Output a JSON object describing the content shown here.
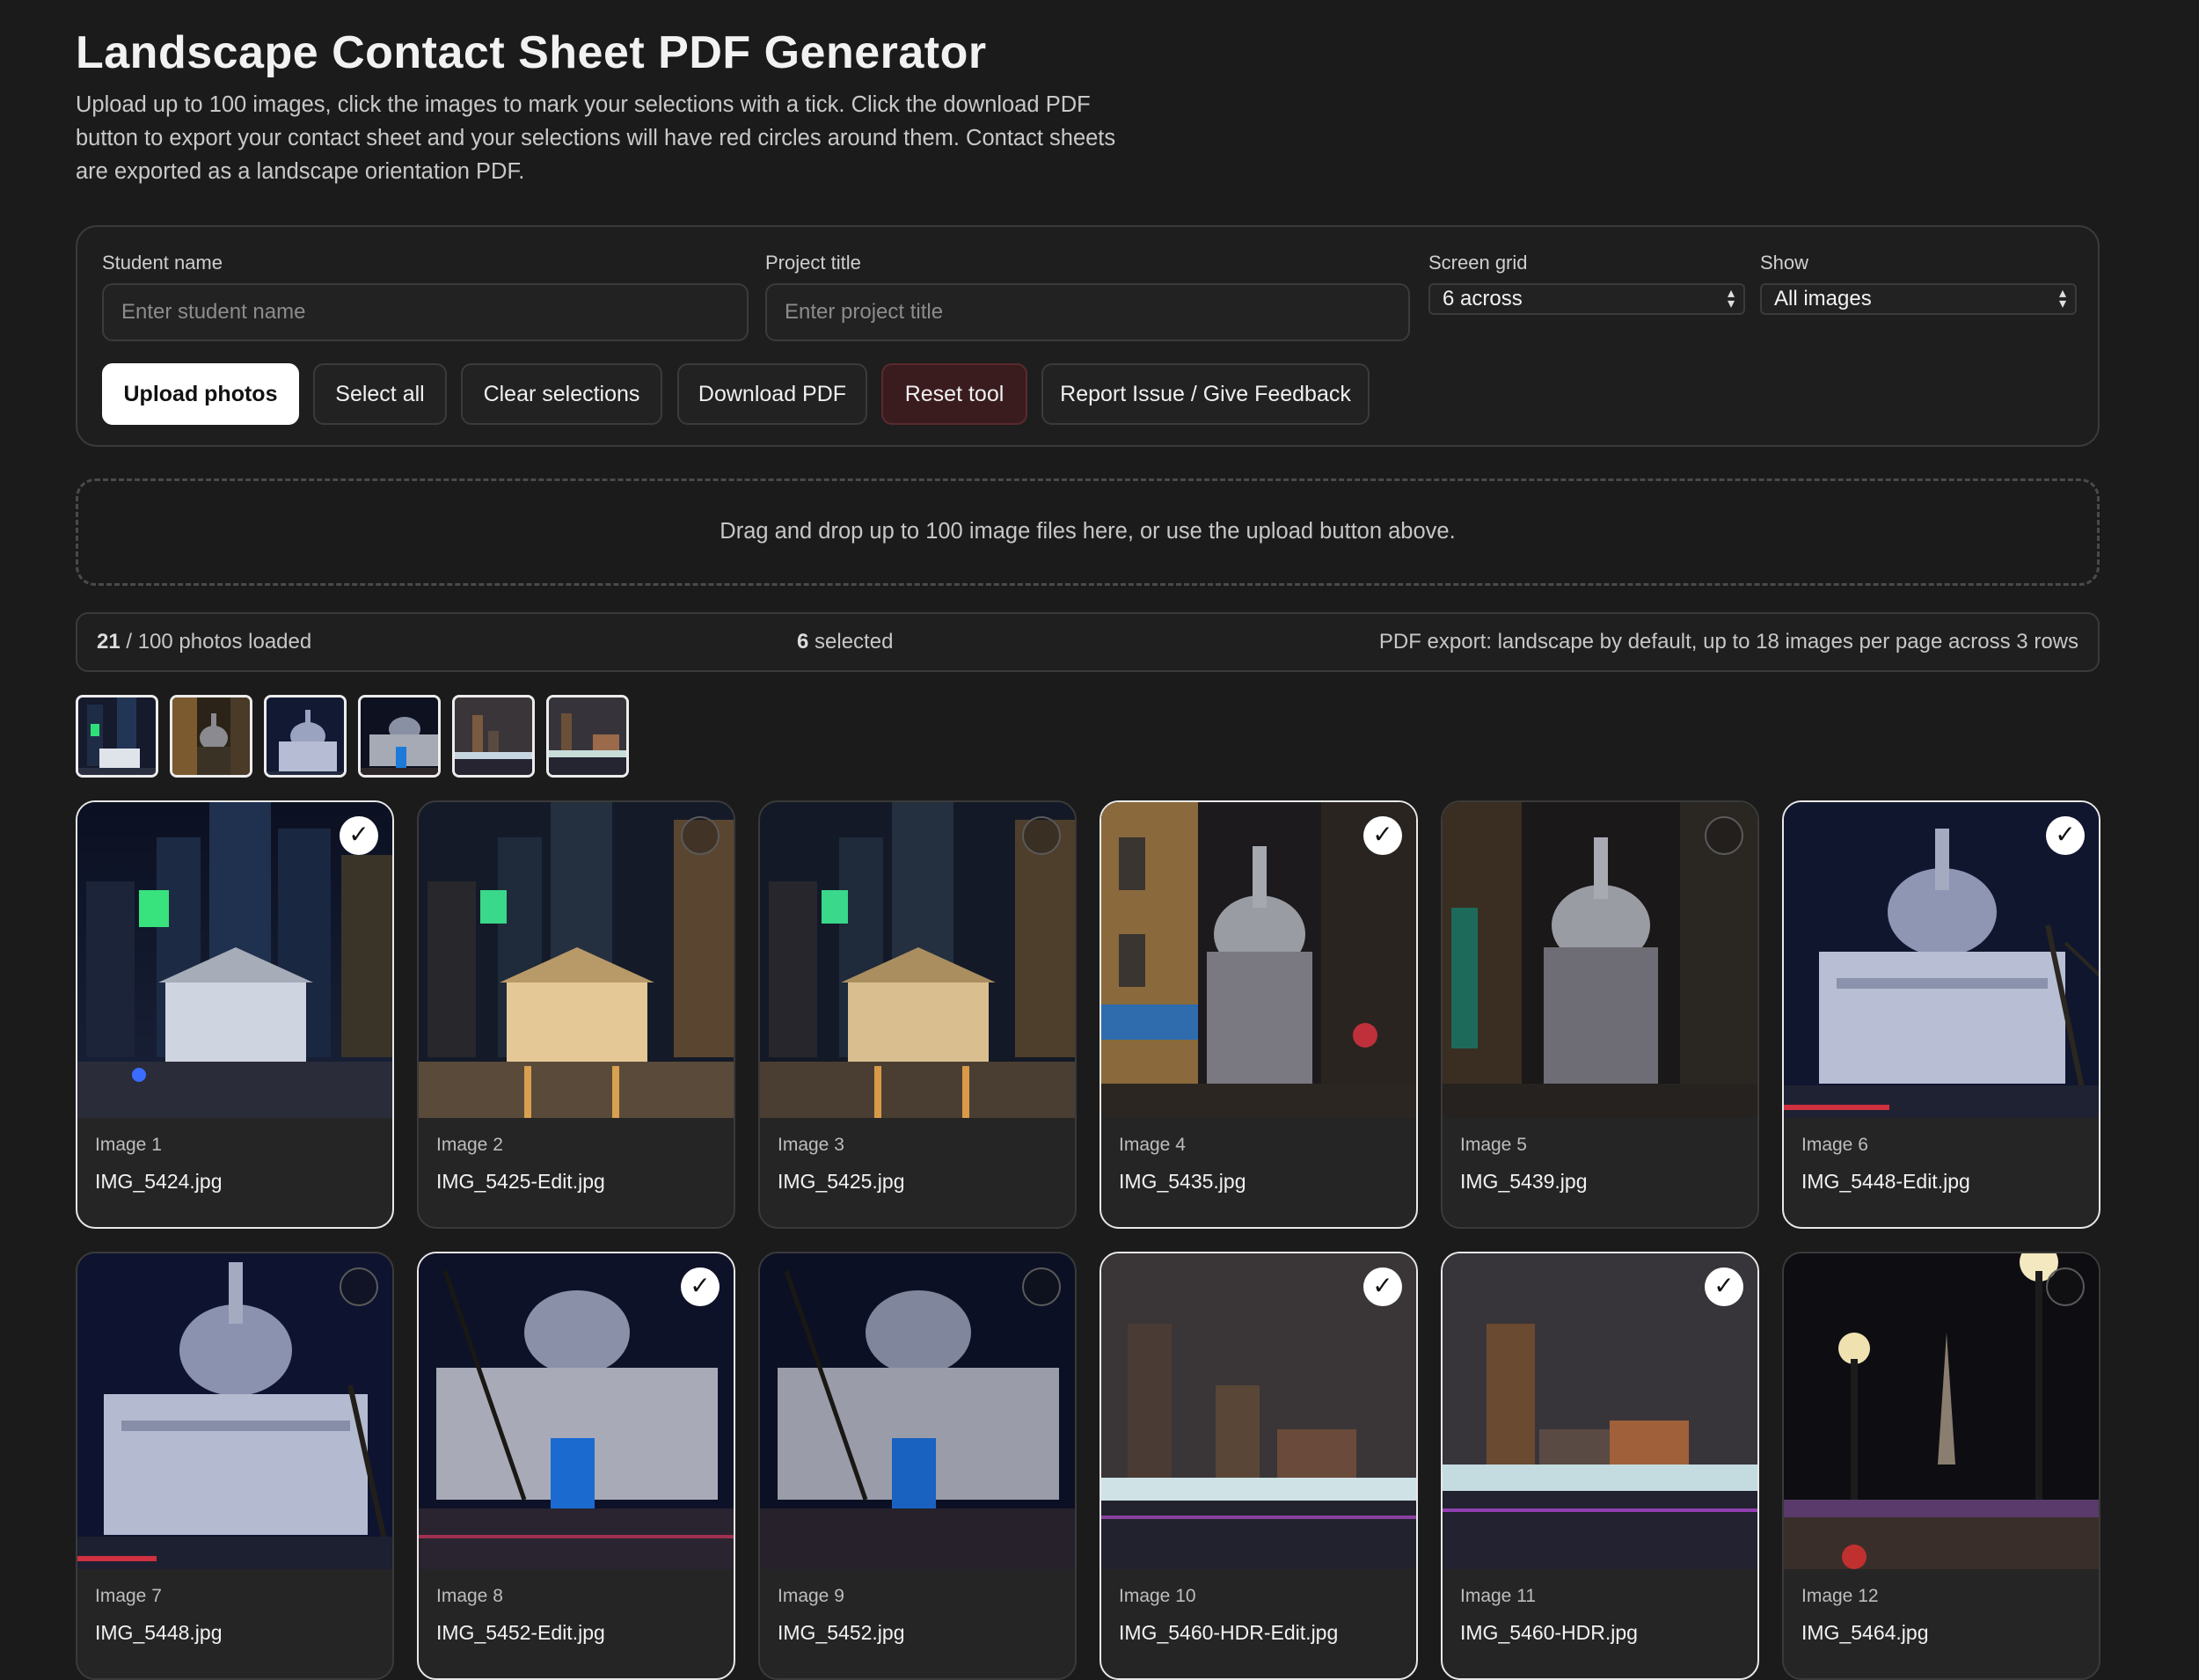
{
  "header": {
    "title": "Landscape Contact Sheet PDF Generator",
    "intro": "Upload up to 100 images, click the images to mark your selections with a tick. Click the download PDF button to export your contact sheet and your selections will have red circles around them. Contact sheets are exported as a landscape orientation PDF."
  },
  "form": {
    "student_label": "Student name",
    "student_placeholder": "Enter student name",
    "project_label": "Project title",
    "project_placeholder": "Enter project title",
    "grid_label": "Screen grid",
    "grid_value": "6 across",
    "show_label": "Show",
    "show_value": "All images"
  },
  "buttons": {
    "upload": "Upload photos",
    "select_all": "Select all",
    "clear": "Clear selections",
    "download": "Download PDF",
    "reset": "Reset tool",
    "feedback": "Report Issue / Give Feedback"
  },
  "dropzone": "Drag and drop up to 100 image files here, or use the upload button above.",
  "status": {
    "loaded_count": "21",
    "loaded_text": " / 100 photos loaded",
    "selected_count": "6",
    "selected_text": " selected",
    "export_info": "PDF export: landscape by default, up to 18 images per page across 3 rows"
  },
  "colors": {
    "background": "#1b1b1b",
    "accent_primary": "#ffffff",
    "danger": "#3a1c1f"
  },
  "images": [
    {
      "label": "Image 1",
      "file": "IMG_5424.jpg",
      "selected": true
    },
    {
      "label": "Image 2",
      "file": "IMG_5425-Edit.jpg",
      "selected": false
    },
    {
      "label": "Image 3",
      "file": "IMG_5425.jpg",
      "selected": false
    },
    {
      "label": "Image 4",
      "file": "IMG_5435.jpg",
      "selected": true
    },
    {
      "label": "Image 5",
      "file": "IMG_5439.jpg",
      "selected": false
    },
    {
      "label": "Image 6",
      "file": "IMG_5448-Edit.jpg",
      "selected": true
    },
    {
      "label": "Image 7",
      "file": "IMG_5448.jpg",
      "selected": false
    },
    {
      "label": "Image 8",
      "file": "IMG_5452-Edit.jpg",
      "selected": true
    },
    {
      "label": "Image 9",
      "file": "IMG_5452.jpg",
      "selected": false
    },
    {
      "label": "Image 10",
      "file": "IMG_5460-HDR-Edit.jpg",
      "selected": true
    },
    {
      "label": "Image 11",
      "file": "IMG_5460-HDR.jpg",
      "selected": true
    },
    {
      "label": "Image 12",
      "file": "IMG_5464.jpg",
      "selected": false
    }
  ],
  "tick_glyph": "✓",
  "selected_thumbs": 6
}
